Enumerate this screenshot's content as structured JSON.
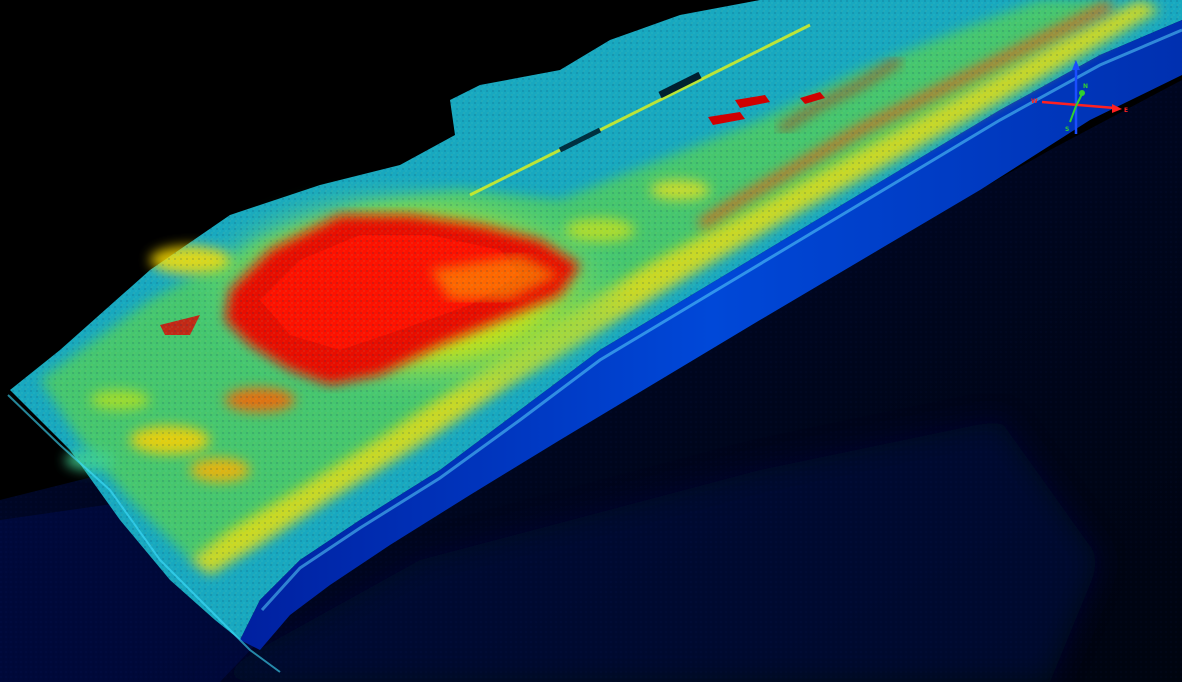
{
  "view": {
    "type": "lidar point cloud elevation render",
    "colormap": [
      "#000a6e",
      "#0030d0",
      "#00b4d8",
      "#39d0a0",
      "#a8e020",
      "#ffe000",
      "#ff8000",
      "#e00000"
    ],
    "background": "#000000"
  },
  "compass": {
    "north_label": "N",
    "south_label": "S",
    "east_label": "E",
    "west_label": "W",
    "north_color": "#1a4dff",
    "east_color": "#ff2020",
    "up_color": "#30d030"
  }
}
